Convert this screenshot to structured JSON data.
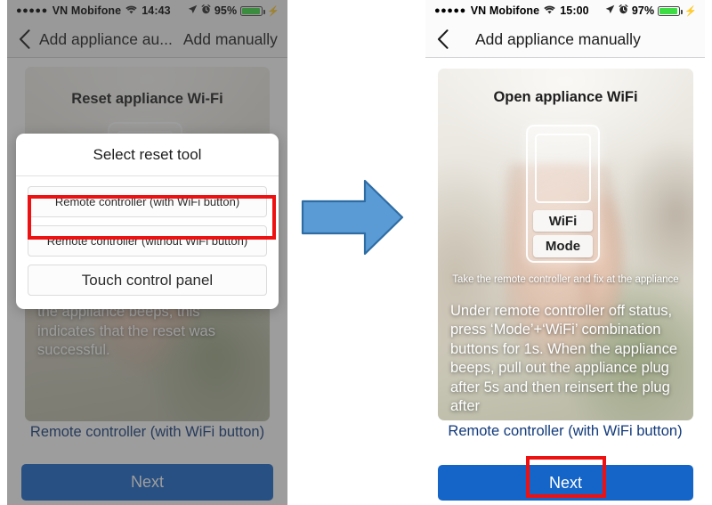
{
  "left_phone": {
    "status_bar": {
      "signal_dots": "●●●●●",
      "carrier": "VN Mobifone",
      "wifi_icon": "wifi-icon",
      "time": "14:43",
      "location_icon": "location-arrow-icon",
      "alarm_icon": "alarm-clock-icon",
      "battery_percent": "95%",
      "charging_icon": "lightning-bolt-icon"
    },
    "nav": {
      "back_icon": "back-chevron-icon",
      "title": "Add appliance au...",
      "secondary_title": "Add manually"
    },
    "card": {
      "overlay_title": "Reset appliance Wi-Fi",
      "instruction": "combination buttons for 1s. Once the appliance beeps, this indicates that the reset was successful."
    },
    "link_text": "Remote controller (with WiFi button)",
    "next_label": "Next",
    "dialog": {
      "title": "Select reset tool",
      "options": [
        "Remote controller (with WiFi button)",
        "Remote controller (without WiFi button)",
        "Touch control panel"
      ],
      "highlighted_option_index": 0
    }
  },
  "right_phone": {
    "status_bar": {
      "signal_dots": "●●●●●",
      "carrier": "VN Mobifone",
      "wifi_icon": "wifi-icon",
      "time": "15:00",
      "location_icon": "location-arrow-icon",
      "alarm_icon": "alarm-clock-icon",
      "battery_percent": "97%",
      "charging_icon": "lightning-bolt-icon"
    },
    "nav": {
      "back_icon": "back-chevron-icon",
      "title": "Add appliance manually"
    },
    "card": {
      "overlay_title": "Open appliance WiFi",
      "remote_buttons": [
        "WiFi",
        "Mode"
      ],
      "photo_caption": "Take the remote controller and fix at the appliance",
      "instruction": "Under remote controller off status, press ‘Mode’+‘WiFi’ combination buttons for 1s. When the appliance beeps, pull out the appliance plug after 5s and then reinsert the plug after"
    },
    "link_text": "Remote controller (with WiFi button)",
    "next_label": "Next"
  },
  "annotations": {
    "arrow_icon": "right-arrow-icon",
    "highlight_color": "#ee1111",
    "arrow_fill": "#5b9bd5",
    "arrow_stroke": "#2e6da4",
    "accent_blue": "#1565c8",
    "link_blue": "#123a7a"
  }
}
